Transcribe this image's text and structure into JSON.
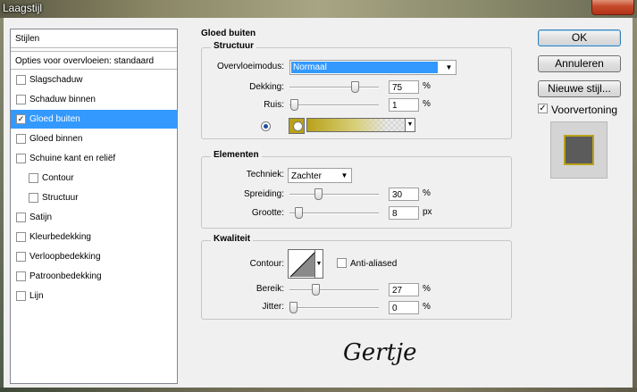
{
  "window": {
    "title": "Laagstijl"
  },
  "styles_list": {
    "header": "Stijlen",
    "blend_options": "Opties voor overvloeien: standaard",
    "items": [
      {
        "label": "Slagschaduw",
        "checked": false,
        "selected": false,
        "indent": false
      },
      {
        "label": "Schaduw binnen",
        "checked": false,
        "selected": false,
        "indent": false
      },
      {
        "label": "Gloed buiten",
        "checked": true,
        "selected": true,
        "indent": false
      },
      {
        "label": "Gloed binnen",
        "checked": false,
        "selected": false,
        "indent": false
      },
      {
        "label": "Schuine kant en reliëf",
        "checked": false,
        "selected": false,
        "indent": false
      },
      {
        "label": "Contour",
        "checked": false,
        "selected": false,
        "indent": true
      },
      {
        "label": "Structuur",
        "checked": false,
        "selected": false,
        "indent": true
      },
      {
        "label": "Satijn",
        "checked": false,
        "selected": false,
        "indent": false
      },
      {
        "label": "Kleurbedekking",
        "checked": false,
        "selected": false,
        "indent": false
      },
      {
        "label": "Verloopbedekking",
        "checked": false,
        "selected": false,
        "indent": false
      },
      {
        "label": "Patroonbedekking",
        "checked": false,
        "selected": false,
        "indent": false
      },
      {
        "label": "Lijn",
        "checked": false,
        "selected": false,
        "indent": false
      }
    ]
  },
  "panel": {
    "title": "Gloed buiten",
    "structure": {
      "title": "Structuur",
      "blend_mode_label": "Overvloeimodus:",
      "blend_mode_value": "Normaal",
      "opacity_label": "Dekking:",
      "opacity_value": "75",
      "opacity_unit": "%",
      "noise_label": "Ruis:",
      "noise_value": "1",
      "noise_unit": "%",
      "glow_color": "#b9a21a"
    },
    "elements": {
      "title": "Elementen",
      "technique_label": "Techniek:",
      "technique_value": "Zachter",
      "spread_label": "Spreiding:",
      "spread_value": "30",
      "spread_unit": "%",
      "size_label": "Grootte:",
      "size_value": "8",
      "size_unit": "px"
    },
    "quality": {
      "title": "Kwaliteit",
      "contour_label": "Contour:",
      "anti_aliased_label": "Anti-aliased",
      "range_label": "Bereik:",
      "range_value": "27",
      "range_unit": "%",
      "jitter_label": "Jitter:",
      "jitter_value": "0",
      "jitter_unit": "%"
    }
  },
  "buttons": {
    "ok": "OK",
    "cancel": "Annuleren",
    "new_style": "Nieuwe stijl...",
    "preview_label": "Voorvertoning",
    "preview_checked": true
  },
  "signature": "Gertje",
  "colors": {
    "selection": "#3399ff",
    "glow": "#b9a21a"
  }
}
